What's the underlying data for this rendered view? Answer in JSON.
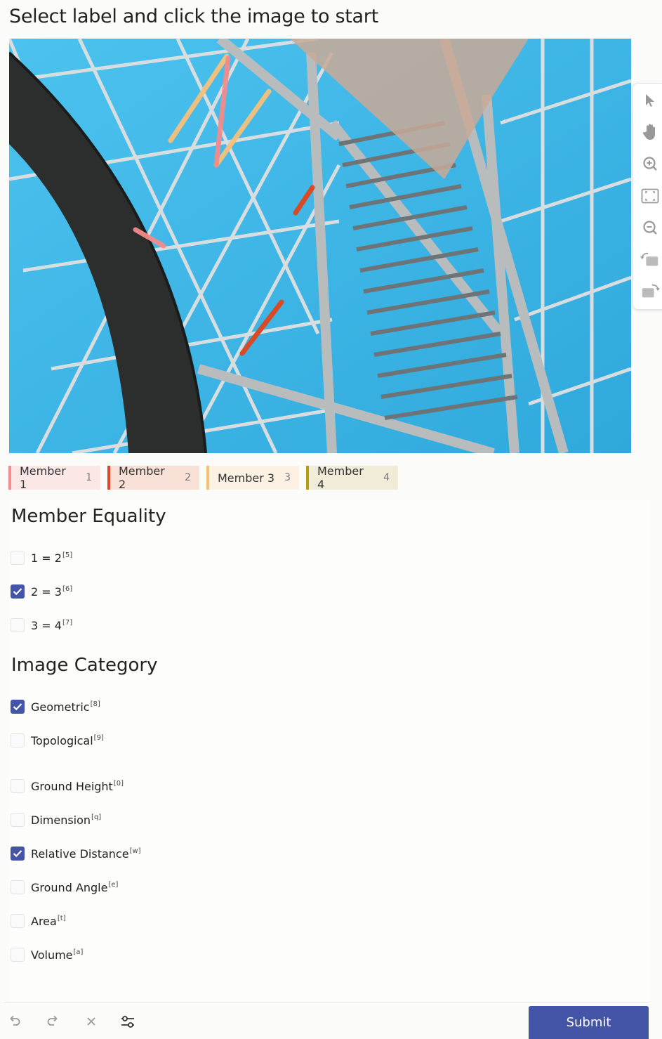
{
  "header": {
    "title": "Select label and click the image to start"
  },
  "toolbar": {
    "tools": [
      "pointer-icon",
      "hand-pan-icon",
      "zoom-in-icon",
      "fit-screen-icon",
      "zoom-out-icon",
      "rotate-left-icon",
      "rotate-right-icon"
    ]
  },
  "labels": [
    {
      "name": "Member 1",
      "key": "1",
      "color": "#f28b8b",
      "bg": "#fbe7e6"
    },
    {
      "name": "Member 2",
      "key": "2",
      "color": "#d94a26",
      "bg": "#f9e0d6"
    },
    {
      "name": "Member 3",
      "key": "3",
      "color": "#f6c07a",
      "bg": "#fcf1e3"
    },
    {
      "name": "Member 4",
      "key": "4",
      "color": "#b89a10",
      "bg": "#f1ecd8"
    }
  ],
  "equality": {
    "title": "Member Equality",
    "items": [
      {
        "label": "1 = 2",
        "key": "[5]",
        "checked": false
      },
      {
        "label": "2 = 3",
        "key": "[6]",
        "checked": true
      },
      {
        "label": "3 = 4",
        "key": "[7]",
        "checked": false
      }
    ]
  },
  "category": {
    "title": "Image Category",
    "items": [
      {
        "label": "Geometric",
        "key": "[8]",
        "checked": true
      },
      {
        "label": "Topological",
        "key": "[9]",
        "checked": false
      },
      {
        "label": "Ground Height",
        "key": "[0]",
        "checked": false
      },
      {
        "label": "Dimension",
        "key": "[q]",
        "checked": false
      },
      {
        "label": "Relative Distance",
        "key": "[w]",
        "checked": true
      },
      {
        "label": "Ground Angle",
        "key": "[e]",
        "checked": false
      },
      {
        "label": "Area",
        "key": "[t]",
        "checked": false
      },
      {
        "label": "Volume",
        "key": "[a]",
        "checked": false
      }
    ]
  },
  "footer": {
    "submit_label": "Submit"
  },
  "colors": {
    "accent": "#4455a7"
  }
}
